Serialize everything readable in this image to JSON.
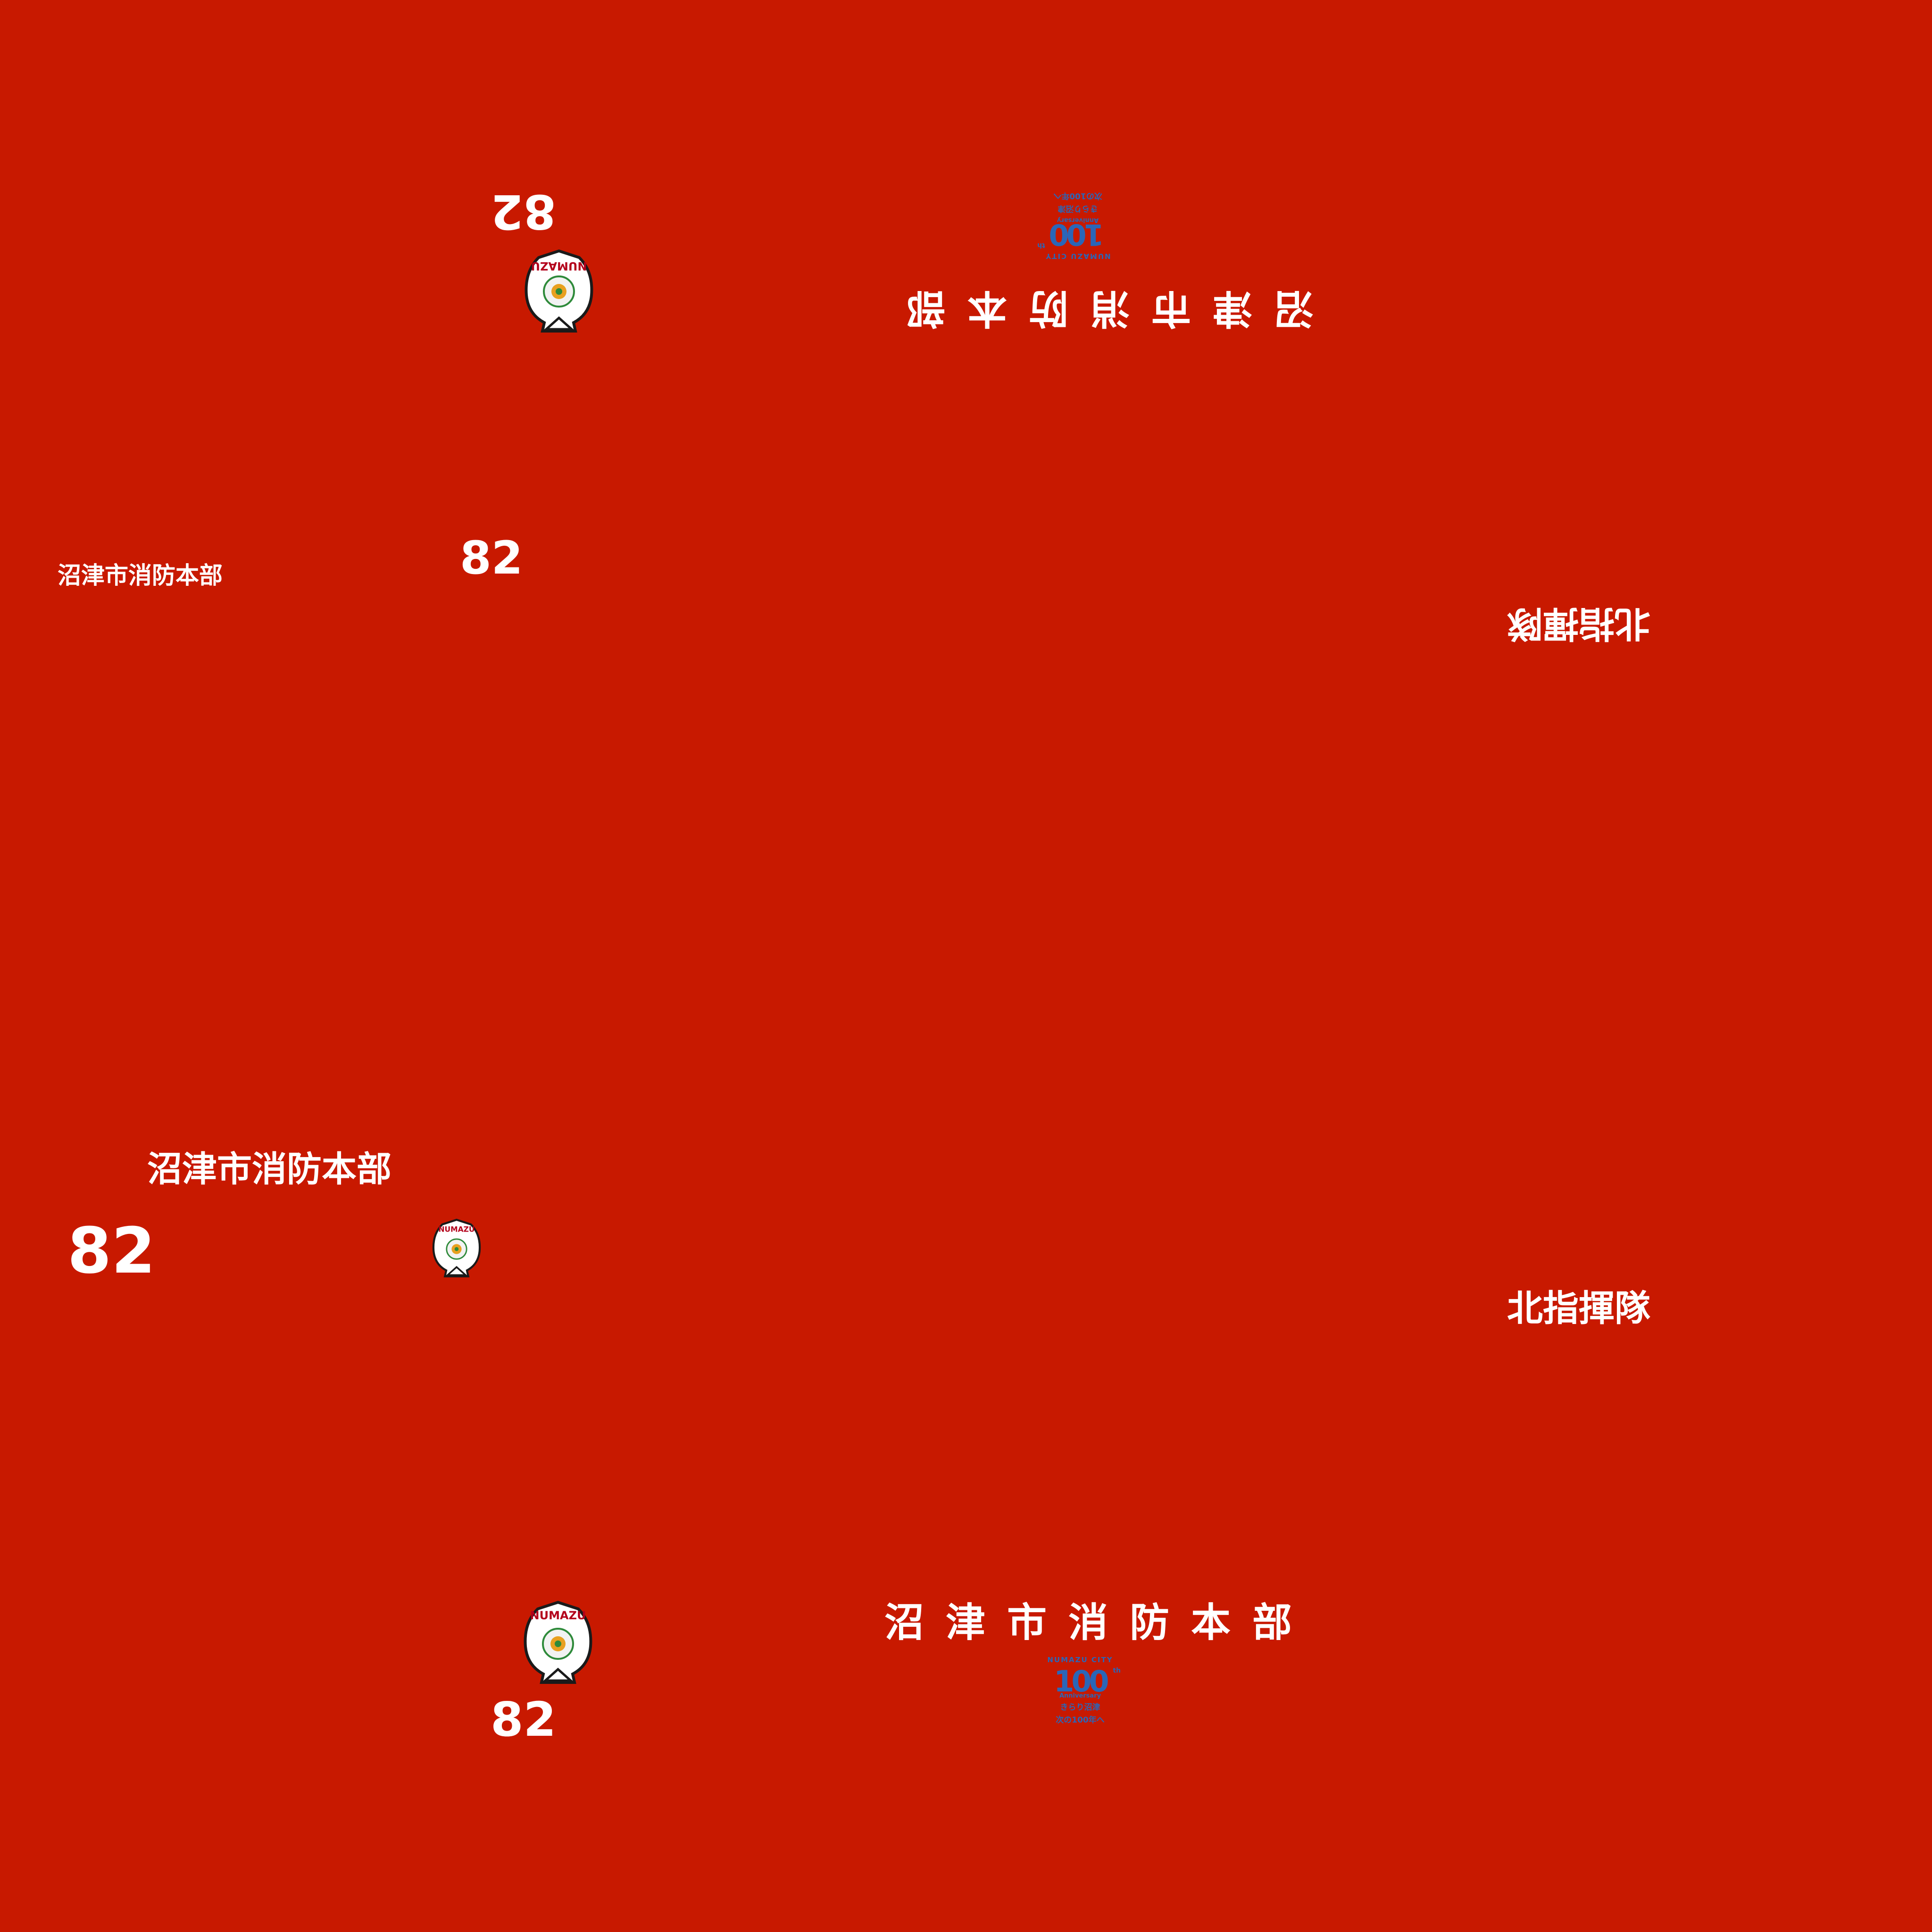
{
  "department": "沼津市消防本部",
  "unit_number": "82",
  "squad": "北指揮隊",
  "emblem": {
    "label": "NUMAZU",
    "icon": "numazu-city-emblem-icon"
  },
  "anniversary_logo": {
    "city": "NUMAZU CITY",
    "number": "100",
    "suffix": "th",
    "sub": "Anniversary",
    "tagline_1": "きらり沼津",
    "tagline_2": "次の100年へ",
    "icon": "numazu-100th-anniversary-logo"
  },
  "colors": {
    "background": "#c81900",
    "text": "#ffffff",
    "logo_blue": "#2a66b8"
  }
}
